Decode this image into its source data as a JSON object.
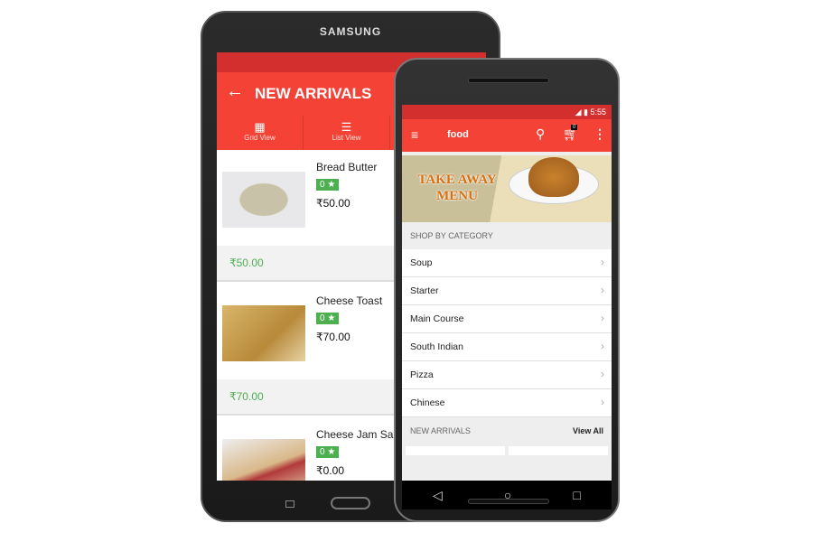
{
  "tablet": {
    "brand": "SAMSUNG",
    "toolbar": {
      "title": "NEW ARRIVALS"
    },
    "tabs": [
      {
        "label": "Grid View",
        "icon": "grid-icon"
      },
      {
        "label": "List View",
        "icon": "list-icon"
      }
    ],
    "items": [
      {
        "name": "Bread Butter",
        "rating": "0 ★",
        "price": "₹50.00",
        "total": "₹50.00"
      },
      {
        "name": "Cheese Toast",
        "rating": "0 ★",
        "price": "₹70.00",
        "total": "₹70.00"
      },
      {
        "name": "Cheese Jam Sandwich",
        "rating": "0 ★",
        "price": "₹0.00"
      }
    ]
  },
  "phone": {
    "status": {
      "time": "5:55"
    },
    "toolbar": {
      "title": "food",
      "cart_count": "0"
    },
    "banner": {
      "line1": "TAKE AWAY",
      "line2": "MENU"
    },
    "shop_by_category": "SHOP BY CATEGORY",
    "categories": [
      "Soup",
      "Starter",
      "Main Course",
      "South Indian",
      "Pizza",
      "Chinese"
    ],
    "new_arrivals": {
      "label": "NEW ARRIVALS",
      "view_all": "View All"
    }
  },
  "colors": {
    "primary": "#f44336",
    "primary_dark": "#d32f2f",
    "rating": "#4caf50"
  }
}
